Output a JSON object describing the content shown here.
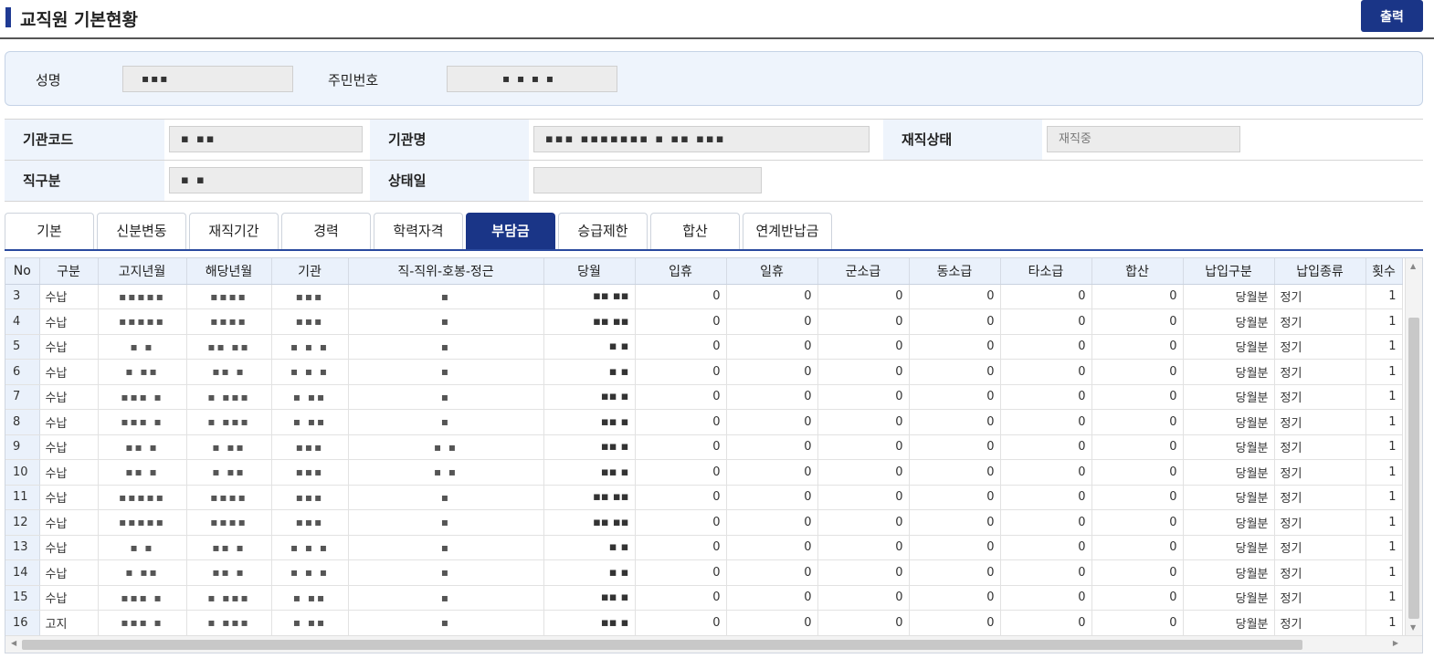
{
  "header": {
    "title": "교직원 기본현황",
    "print_label": "출력"
  },
  "person": {
    "name_label": "성명",
    "name_value": "▪▪▪",
    "rrn_label": "주민번호",
    "rrn_value": "▪ ▪  ▪  ▪"
  },
  "info": {
    "org_code_label": "기관코드",
    "org_code_value": "▪ ▪▪",
    "org_name_label": "기관명",
    "org_name_value": "▪▪▪ ▪▪▪▪▪▪▪ ▪ ▪▪ ▪▪▪",
    "status_label": "재직상태",
    "status_value": "재직중",
    "job_label": "직구분",
    "job_value": "▪ ▪",
    "status_date_label": "상태일",
    "status_date_value": ""
  },
  "tabs": [
    {
      "label": "기본"
    },
    {
      "label": "신분변동"
    },
    {
      "label": "재직기간"
    },
    {
      "label": "경력"
    },
    {
      "label": "학력자격"
    },
    {
      "label": "부담금"
    },
    {
      "label": "승급제한"
    },
    {
      "label": "합산"
    },
    {
      "label": "연계반납금"
    }
  ],
  "grid": {
    "columns": [
      "No",
      "구분",
      "고지년월",
      "해당년월",
      "기관",
      "직-직위-호봉-정근",
      "당월",
      "입휴",
      "일휴",
      "군소급",
      "동소급",
      "타소급",
      "합산",
      "납입구분",
      "납입종류",
      "횟수"
    ],
    "rows": [
      {
        "no": "3",
        "type": "수납",
        "notice": "▪▪▪▪▪",
        "target": "▪▪▪▪",
        "org": "▪▪▪",
        "pos": "▪",
        "month": "▪▪ ▪▪",
        "v1": "0",
        "v2": "0",
        "v3": "0",
        "v4": "0",
        "v5": "0",
        "sum": "0",
        "pay_type": "당월분",
        "pay_kind": "정기",
        "cnt": "1"
      },
      {
        "no": "4",
        "type": "수납",
        "notice": "▪▪▪▪▪",
        "target": "▪▪▪▪",
        "org": "▪▪▪",
        "pos": "▪",
        "month": "▪▪ ▪▪",
        "v1": "0",
        "v2": "0",
        "v3": "0",
        "v4": "0",
        "v5": "0",
        "sum": "0",
        "pay_type": "당월분",
        "pay_kind": "정기",
        "cnt": "1"
      },
      {
        "no": "5",
        "type": "수납",
        "notice": "▪ ▪",
        "target": "▪▪ ▪▪",
        "org": "▪ ▪ ▪",
        "pos": "▪",
        "month": "▪ ▪",
        "v1": "0",
        "v2": "0",
        "v3": "0",
        "v4": "0",
        "v5": "0",
        "sum": "0",
        "pay_type": "당월분",
        "pay_kind": "정기",
        "cnt": "1"
      },
      {
        "no": "6",
        "type": "수납",
        "notice": "▪ ▪▪",
        "target": "▪▪ ▪",
        "org": "▪ ▪ ▪",
        "pos": "▪",
        "month": "▪ ▪",
        "v1": "0",
        "v2": "0",
        "v3": "0",
        "v4": "0",
        "v5": "0",
        "sum": "0",
        "pay_type": "당월분",
        "pay_kind": "정기",
        "cnt": "1"
      },
      {
        "no": "7",
        "type": "수납",
        "notice": "▪▪▪ ▪",
        "target": "▪ ▪▪▪",
        "org": "▪ ▪▪",
        "pos": "▪",
        "month": "▪▪ ▪",
        "v1": "0",
        "v2": "0",
        "v3": "0",
        "v4": "0",
        "v5": "0",
        "sum": "0",
        "pay_type": "당월분",
        "pay_kind": "정기",
        "cnt": "1"
      },
      {
        "no": "8",
        "type": "수납",
        "notice": "▪▪▪ ▪",
        "target": "▪ ▪▪▪",
        "org": "▪ ▪▪",
        "pos": "▪",
        "month": "▪▪ ▪",
        "v1": "0",
        "v2": "0",
        "v3": "0",
        "v4": "0",
        "v5": "0",
        "sum": "0",
        "pay_type": "당월분",
        "pay_kind": "정기",
        "cnt": "1"
      },
      {
        "no": "9",
        "type": "수납",
        "notice": "▪▪ ▪",
        "target": "▪ ▪▪",
        "org": "▪▪▪",
        "pos": "▪ ▪",
        "month": "▪▪ ▪",
        "v1": "0",
        "v2": "0",
        "v3": "0",
        "v4": "0",
        "v5": "0",
        "sum": "0",
        "pay_type": "당월분",
        "pay_kind": "정기",
        "cnt": "1"
      },
      {
        "no": "10",
        "type": "수납",
        "notice": "▪▪ ▪",
        "target": "▪ ▪▪",
        "org": "▪▪▪",
        "pos": "▪ ▪",
        "month": "▪▪ ▪",
        "v1": "0",
        "v2": "0",
        "v3": "0",
        "v4": "0",
        "v5": "0",
        "sum": "0",
        "pay_type": "당월분",
        "pay_kind": "정기",
        "cnt": "1"
      },
      {
        "no": "11",
        "type": "수납",
        "notice": "▪▪▪▪▪",
        "target": "▪▪▪▪",
        "org": "▪▪▪",
        "pos": "▪",
        "month": "▪▪ ▪▪",
        "v1": "0",
        "v2": "0",
        "v3": "0",
        "v4": "0",
        "v5": "0",
        "sum": "0",
        "pay_type": "당월분",
        "pay_kind": "정기",
        "cnt": "1"
      },
      {
        "no": "12",
        "type": "수납",
        "notice": "▪▪▪▪▪",
        "target": "▪▪▪▪",
        "org": "▪▪▪",
        "pos": "▪",
        "month": "▪▪ ▪▪",
        "v1": "0",
        "v2": "0",
        "v3": "0",
        "v4": "0",
        "v5": "0",
        "sum": "0",
        "pay_type": "당월분",
        "pay_kind": "정기",
        "cnt": "1"
      },
      {
        "no": "13",
        "type": "수납",
        "notice": "▪ ▪",
        "target": "▪▪ ▪",
        "org": "▪ ▪ ▪",
        "pos": "▪",
        "month": "▪ ▪",
        "v1": "0",
        "v2": "0",
        "v3": "0",
        "v4": "0",
        "v5": "0",
        "sum": "0",
        "pay_type": "당월분",
        "pay_kind": "정기",
        "cnt": "1"
      },
      {
        "no": "14",
        "type": "수납",
        "notice": "▪ ▪▪",
        "target": "▪▪ ▪",
        "org": "▪ ▪ ▪",
        "pos": "▪",
        "month": "▪ ▪",
        "v1": "0",
        "v2": "0",
        "v3": "0",
        "v4": "0",
        "v5": "0",
        "sum": "0",
        "pay_type": "당월분",
        "pay_kind": "정기",
        "cnt": "1"
      },
      {
        "no": "15",
        "type": "수납",
        "notice": "▪▪▪ ▪",
        "target": "▪ ▪▪▪",
        "org": "▪ ▪▪",
        "pos": "▪",
        "month": "▪▪ ▪",
        "v1": "0",
        "v2": "0",
        "v3": "0",
        "v4": "0",
        "v5": "0",
        "sum": "0",
        "pay_type": "당월분",
        "pay_kind": "정기",
        "cnt": "1"
      },
      {
        "no": "16",
        "type": "고지",
        "notice": "▪▪▪ ▪",
        "target": "▪ ▪▪▪",
        "org": "▪ ▪▪",
        "pos": "▪",
        "month": "▪▪ ▪",
        "v1": "0",
        "v2": "0",
        "v3": "0",
        "v4": "0",
        "v5": "0",
        "sum": "0",
        "pay_type": "당월분",
        "pay_kind": "정기",
        "cnt": "1"
      }
    ]
  },
  "colors": {
    "accent": "#1a3587",
    "header_bg": "#eef4fc"
  }
}
